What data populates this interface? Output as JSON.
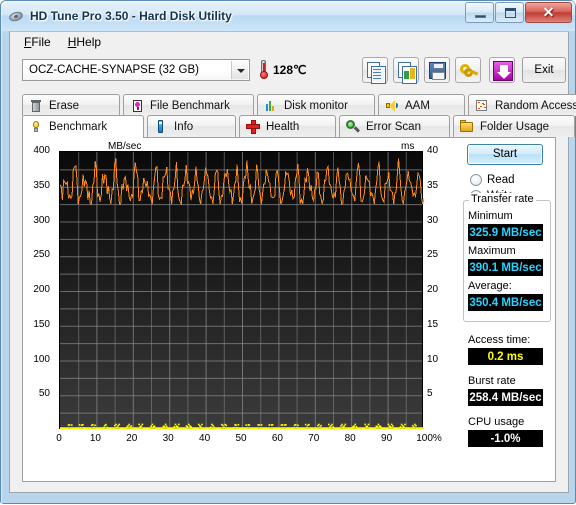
{
  "window": {
    "title": "HD Tune Pro 3.50 - Hard Disk Utility",
    "icon": "hard-disk-icon",
    "minimize_label": "",
    "maximize_label": "",
    "close_label": "✕"
  },
  "menu": {
    "items": [
      {
        "label": "File",
        "accel": "F"
      },
      {
        "label": "Help",
        "accel": "H"
      }
    ]
  },
  "toolbar": {
    "drive": {
      "selected": "OCZ-CACHE-SYNAPSE (32 GB)",
      "options": [
        "OCZ-CACHE-SYNAPSE (32 GB)"
      ]
    },
    "temperature": "128℃",
    "buttons": [
      {
        "name": "copy-to-clipboard",
        "icon": "copy-document-icon"
      },
      {
        "name": "copy-image",
        "icon": "copy-image-icon"
      },
      {
        "name": "save",
        "icon": "floppy-save-icon"
      },
      {
        "name": "options-key",
        "icon": "key-icon"
      },
      {
        "name": "download",
        "icon": "purple-down-arrow-icon"
      }
    ],
    "exit_label": "Exit"
  },
  "tabs": {
    "top_row": [
      {
        "label": "Erase",
        "icon": "trash-icon",
        "active": false
      },
      {
        "label": "File Benchmark",
        "icon": "file-benchmark-icon",
        "active": false
      },
      {
        "label": "Disk monitor",
        "icon": "bar-chart-icon",
        "active": false
      },
      {
        "label": "AAM",
        "icon": "speaker-icon",
        "active": false
      },
      {
        "label": "Random Access",
        "icon": "random-dots-icon",
        "active": false
      }
    ],
    "bottom_row": [
      {
        "label": "Benchmark",
        "icon": "lightbulb-icon",
        "active": true
      },
      {
        "label": "Info",
        "icon": "info-icon",
        "active": false
      },
      {
        "label": "Health",
        "icon": "red-cross-icon",
        "active": false
      },
      {
        "label": "Error Scan",
        "icon": "magnifier-icon",
        "active": false
      },
      {
        "label": "Folder Usage",
        "icon": "folder-icon",
        "active": false
      }
    ]
  },
  "side": {
    "start_label": "Start",
    "mode": {
      "read_label": "Read",
      "write_label": "Write",
      "selected": "Write"
    },
    "transfer_rate": {
      "group_label": "Transfer rate",
      "minimum_label": "Minimum",
      "minimum_value": "325.9 MB/sec",
      "maximum_label": "Maximum",
      "maximum_value": "390.1 MB/sec",
      "average_label": "Average:",
      "average_value": "350.4 MB/sec"
    },
    "access_time_label": "Access time:",
    "access_time_value": "0.2 ms",
    "burst_rate_label": "Burst rate",
    "burst_rate_value": "258.4 MB/sec",
    "cpu_usage_label": "CPU usage",
    "cpu_usage_value": "-1.0%"
  },
  "colors": {
    "transfer_curve": "#ff8c1a",
    "access_time_points": "#ffff00",
    "value_cyan": "#2ad2ff",
    "value_yellow": "#ffff00",
    "value_white": "#ffffff",
    "plot_background_top": "#0a0a0a",
    "plot_background_bottom": "#3b3b3b",
    "gridline": "#8a8a8a",
    "titlebar": "#b9d9f2"
  },
  "chart_data": {
    "type": "line",
    "title": "",
    "xlabel": "",
    "ylabel": "MB/sec",
    "y2label": "ms",
    "xlim": [
      0,
      100
    ],
    "ylim": [
      0,
      400
    ],
    "y2lim": [
      0,
      40
    ],
    "grid": true,
    "legend": "none",
    "xticks": [
      "0",
      "10",
      "20",
      "30",
      "40",
      "50",
      "60",
      "70",
      "80",
      "90",
      "100%"
    ],
    "yticks": [
      "50",
      "100",
      "150",
      "200",
      "250",
      "300",
      "350",
      "400"
    ],
    "y2ticks": [
      "5",
      "10",
      "15",
      "20",
      "25",
      "30",
      "35",
      "40"
    ],
    "series": [
      {
        "name": "Transfer rate",
        "axis": "left",
        "unit": "MB/sec",
        "color": "#ff8c1a",
        "x": [
          0,
          0.7,
          1.4,
          2.1,
          2.8,
          3.5,
          4.2,
          4.9,
          5.6,
          6.3,
          7,
          7.7,
          8.4,
          9.1,
          9.8,
          10.5,
          11.2,
          11.9,
          12.6,
          13.3,
          14,
          14.7,
          15.4,
          16.1,
          16.8,
          17.5,
          18.2,
          18.9,
          19.6,
          20.3,
          21,
          21.7,
          22.4,
          23.1,
          23.8,
          24.5,
          25.2,
          25.9,
          26.6,
          27.3,
          28,
          28.7,
          29.4,
          30.1,
          30.8,
          31.5,
          32.2,
          32.9,
          33.6,
          34.3,
          35,
          35.7,
          36.4,
          37.1,
          37.8,
          38.5,
          39.2,
          39.9,
          40.6,
          41.3,
          42,
          42.7,
          43.4,
          44.1,
          44.8,
          45.5,
          46.2,
          46.9,
          47.6,
          48.3,
          49,
          49.7,
          50.4,
          51.1,
          51.8,
          52.5,
          53.2,
          53.9,
          54.6,
          55.3,
          56,
          56.7,
          57.4,
          58.1,
          58.8,
          59.5,
          60.2,
          60.9,
          61.6,
          62.3,
          63,
          63.7,
          64.4,
          65.1,
          65.8,
          66.5,
          67.2,
          67.9,
          68.6,
          69.3,
          70,
          70.7,
          71.4,
          72.1,
          72.8,
          73.5,
          74.2,
          74.9,
          75.6,
          76.3,
          77,
          77.7,
          78.4,
          79.1,
          79.8,
          80.5,
          81.2,
          81.9,
          82.6,
          83.3,
          84,
          84.7,
          85.4,
          86.1,
          86.8,
          87.5,
          88.2,
          88.9,
          89.6,
          90.3,
          91,
          91.7,
          92.4,
          93.1,
          93.8,
          94.5,
          95.2,
          95.9,
          96.6,
          97.3,
          98,
          98.7,
          99.4,
          100
        ],
        "y": [
          348,
          334,
          372,
          341,
          327,
          358,
          386,
          340,
          330,
          352,
          368,
          336,
          326,
          349,
          381,
          344,
          331,
          357,
          375,
          338,
          328,
          354,
          389,
          342,
          329,
          350,
          370,
          337,
          327,
          356,
          384,
          345,
          332,
          351,
          366,
          339,
          326,
          348,
          380,
          343,
          330,
          355,
          387,
          341,
          328,
          352,
          373,
          336,
          327,
          350,
          383,
          346,
          333,
          357,
          369,
          338,
          329,
          353,
          388,
          342,
          326,
          349,
          377,
          340,
          331,
          354,
          385,
          344,
          328,
          351,
          371,
          337,
          330,
          356,
          390,
          343,
          327,
          348,
          376,
          339,
          332,
          353,
          382,
          345,
          329,
          350,
          374,
          336,
          326,
          352,
          386,
          341,
          331,
          355,
          378,
          338,
          327,
          349,
          384,
          344,
          330,
          351,
          367,
          337,
          328,
          357,
          388,
          342,
          333,
          348,
          372,
          340,
          326,
          354,
          380,
          345,
          329,
          350,
          385,
          339,
          331,
          356,
          370,
          336,
          327,
          352,
          383,
          343,
          330,
          349,
          375,
          338,
          328,
          353,
          389,
          341,
          326,
          350,
          379,
          344,
          332,
          355,
          368,
          337,
          330
        ]
      },
      {
        "name": "Access time",
        "axis": "right",
        "unit": "ms",
        "color": "#ffff00",
        "approx_value_ms": 0.2,
        "note": "Scatter of access-time samples clustered near 0.2 ms along the bottom of the plot"
      }
    ]
  }
}
